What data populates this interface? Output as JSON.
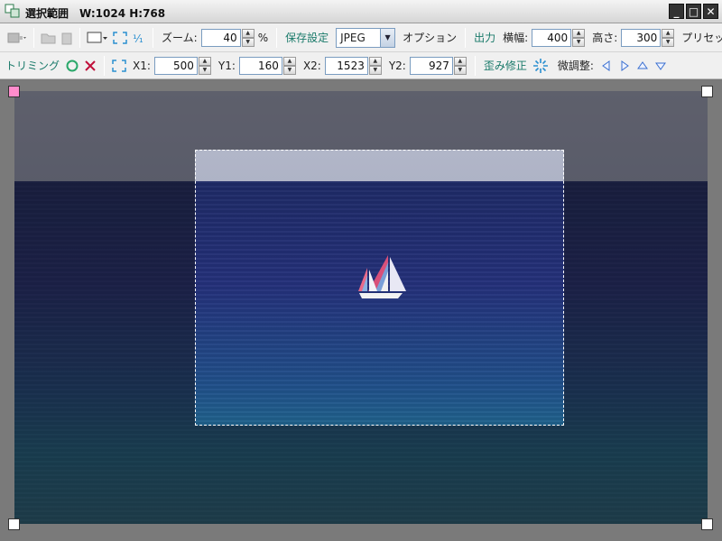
{
  "window": {
    "title": "選択範囲　W:1024  H:768",
    "buttons": {
      "minimize": "_",
      "maximize": "□",
      "close": "✕"
    }
  },
  "toolbar1": {
    "zoom_label": "ズーム:",
    "zoom_value": "40",
    "zoom_unit": "%",
    "save_settings_label": "保存設定",
    "format_value": "JPEG",
    "options_label": "オプション",
    "output_label": "出力",
    "width_label": "横幅:",
    "width_value": "400",
    "height_label": "高さ:",
    "height_value": "300",
    "preset_label": "プリセット"
  },
  "toolbar2": {
    "trim_label": "トリミング",
    "x1_label": "X1:",
    "x1_value": "500",
    "y1_label": "Y1:",
    "y1_value": "160",
    "x2_label": "X2:",
    "x2_value": "1523",
    "y2_label": "Y2:",
    "y2_value": "927",
    "distortion_label": "歪み修正",
    "fine_adjust_label": "微調整:"
  },
  "colors": {
    "accent_green": "#1a7a6a",
    "arrow_blue": "#3a6fd0",
    "handle_pink": "#ff8ccc"
  }
}
